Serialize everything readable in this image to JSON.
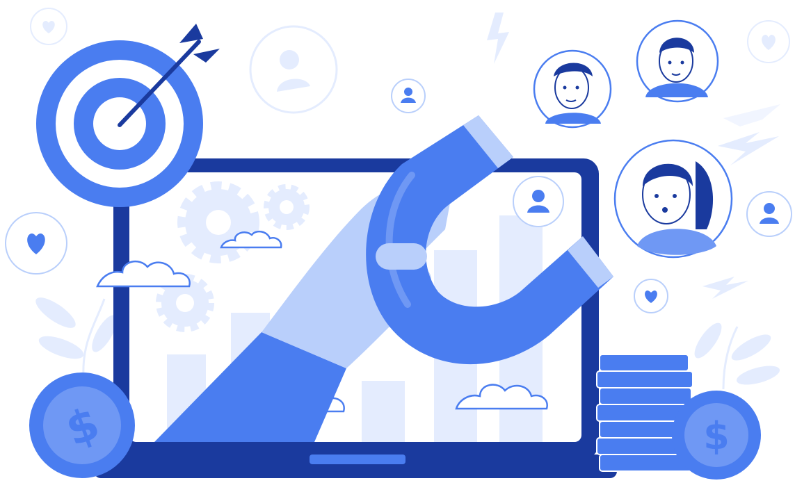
{
  "illustration": {
    "theme": "lead-generation / customer attraction",
    "coin_symbol": "$",
    "colors": {
      "navy": "#1a3a9e",
      "primary": "#4a7df0",
      "medium": "#6f98f4",
      "light": "#b9cffb",
      "pale": "#e4ecfe",
      "faint": "#f1f5ff",
      "white": "#ffffff"
    },
    "icons": [
      "target-icon",
      "dart-icon",
      "magnet-icon",
      "hand-icon",
      "laptop-icon",
      "gear-icon",
      "cloud-icon",
      "heart-icon",
      "user-icon",
      "lightning-icon",
      "coin-icon",
      "coin-stack-icon",
      "leaf-icon",
      "avatar-icon"
    ]
  }
}
